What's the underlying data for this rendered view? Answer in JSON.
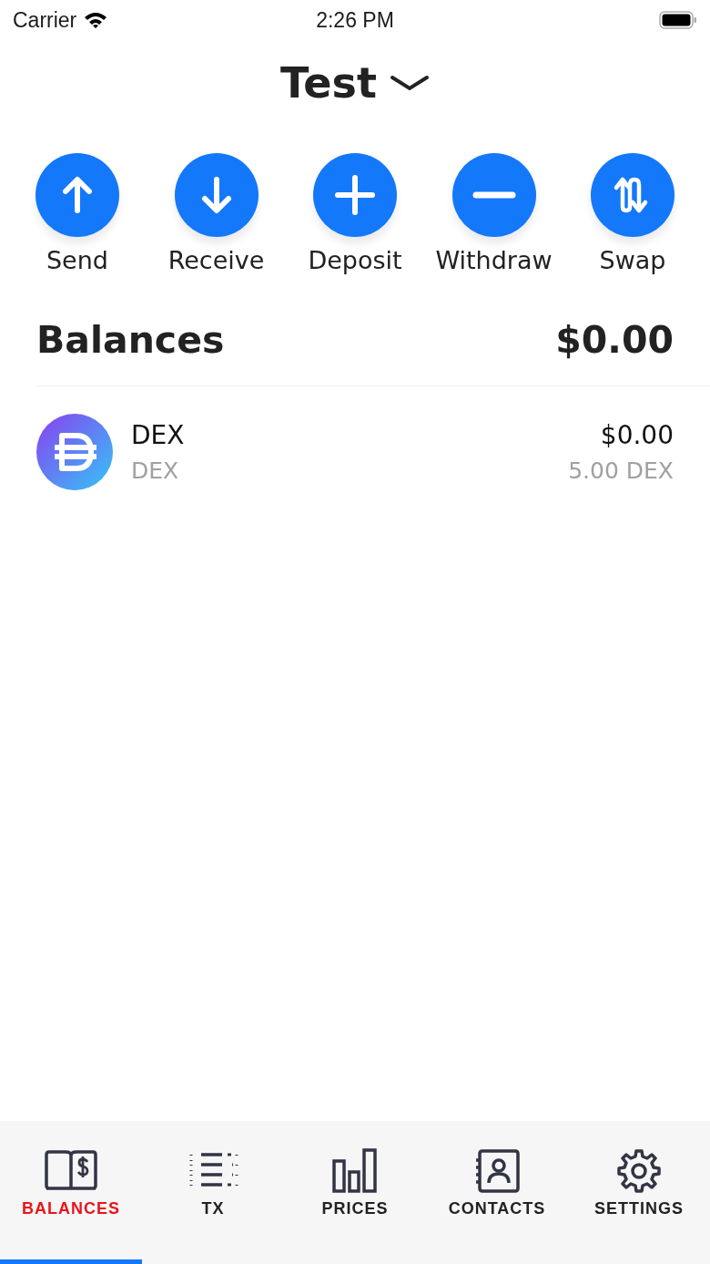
{
  "status_bar": {
    "carrier": "Carrier",
    "time": "2:26 PM"
  },
  "header": {
    "title": "Test"
  },
  "actions": [
    {
      "label": "Send",
      "kind": "send"
    },
    {
      "label": "Receive",
      "kind": "receive"
    },
    {
      "label": "Deposit",
      "kind": "deposit"
    },
    {
      "label": "Withdraw",
      "kind": "withdraw"
    },
    {
      "label": "Swap",
      "kind": "swap"
    }
  ],
  "balances": {
    "title": "Balances",
    "total": "$0.00"
  },
  "tokens": [
    {
      "name": "DEX",
      "symbol": "DEX",
      "value": "$0.00",
      "amount": "5.00 DEX"
    }
  ],
  "tabs": [
    {
      "label": "BALANCES",
      "kind": "balances",
      "selected": true
    },
    {
      "label": "TX",
      "kind": "tx",
      "selected": false
    },
    {
      "label": "PRICES",
      "kind": "prices",
      "selected": false
    },
    {
      "label": "CONTACTS",
      "kind": "contacts",
      "selected": false
    },
    {
      "label": "SETTINGS",
      "kind": "settings",
      "selected": false
    }
  ]
}
